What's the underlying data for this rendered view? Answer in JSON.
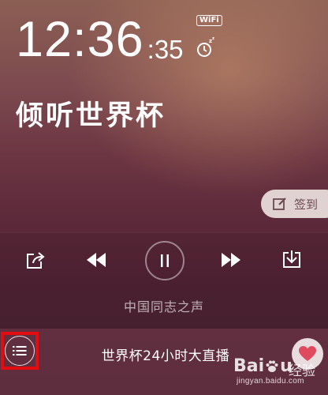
{
  "clock": {
    "hours_minutes": "12:36",
    "seconds": ":35",
    "wifi_badge": "WiFi"
  },
  "station": {
    "title": "倾听世界杯"
  },
  "signin": {
    "label": "签到"
  },
  "player": {
    "broadcaster": "中国同志之声",
    "program_title": "世界杯24小时大直播"
  },
  "watermark": {
    "logo_a": "Bai",
    "logo_b": "u",
    "logo_text": "经验",
    "url": "jingyan.baidu.com"
  },
  "colors": {
    "highlight": "#e30d10",
    "heart": "#e04a5e"
  },
  "icons": [
    "share-icon",
    "previous-icon",
    "pause-icon",
    "next-icon",
    "download-icon",
    "playlist-icon",
    "heart-icon",
    "edit-icon",
    "alarm-snooze-icon"
  ]
}
